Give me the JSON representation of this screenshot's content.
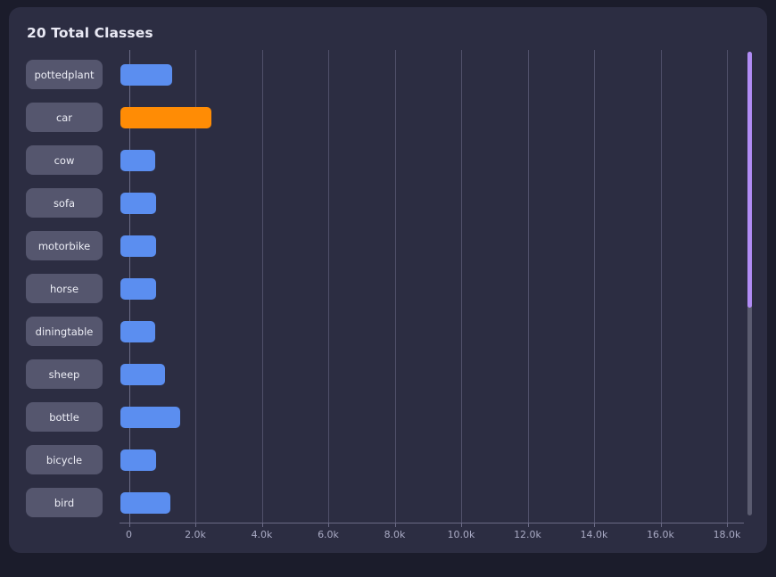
{
  "card": {
    "title": "20 Total Classes"
  },
  "colors": {
    "page_background": "#1b1c2b",
    "card_background": "#2c2d42",
    "bar_default": "#5b8ef0",
    "bar_highlight": "#ff8c05",
    "pill_background": "#55566e",
    "pill_text": "#edeef6",
    "gridline": "#50506a",
    "axis": "#6b6b86",
    "tick_label": "#a9aac4",
    "title_text": "#e9e9f4",
    "scrollbar_thumb": "#b18cf5",
    "scrollbar_track": "#5b5c70"
  },
  "scrollbar": {
    "name": "vertical-scrollbar",
    "thumb_position_percent": 0,
    "thumb_size_percent": 55
  },
  "chart_data": {
    "type": "bar",
    "orientation": "horizontal",
    "title": "20 Total Classes",
    "xlabel": "",
    "ylabel": "",
    "xlim": [
      0,
      18800
    ],
    "grid": true,
    "legend": "none",
    "xtick_labels": [
      "0",
      "2.0k",
      "4.0k",
      "6.0k",
      "8.0k",
      "10.0k",
      "12.0k",
      "14.0k",
      "16.0k",
      "18.0k"
    ],
    "xtick_values": [
      0,
      2000,
      4000,
      6000,
      8000,
      10000,
      12000,
      14000,
      16000,
      18000
    ],
    "categories": [
      "pottedplant",
      "car",
      "cow",
      "sofa",
      "motorbike",
      "horse",
      "diningtable",
      "sheep",
      "bottle",
      "bicycle",
      "bird"
    ],
    "values": [
      1300,
      2490,
      780,
      830,
      830,
      830,
      800,
      1080,
      1540,
      830,
      1250
    ],
    "highlighted_category": "car",
    "total_classes": 20,
    "visible_categories": 11
  }
}
